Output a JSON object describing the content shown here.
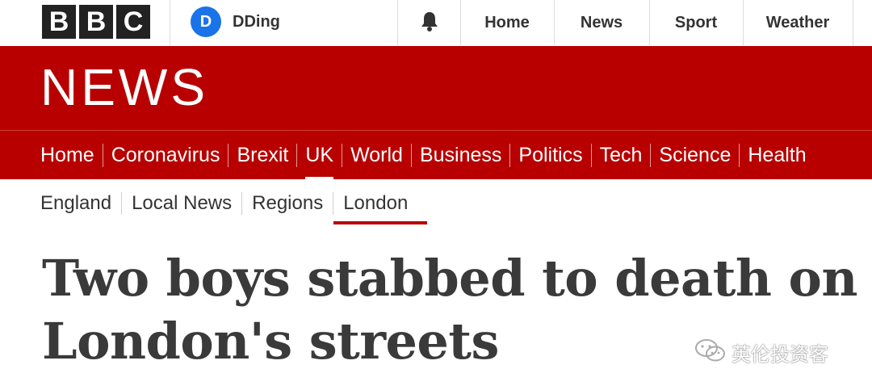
{
  "topbar": {
    "logo_letters": [
      "B",
      "B",
      "C"
    ],
    "account": {
      "initial": "D",
      "name": "DDing"
    },
    "bell_icon": "bell-icon",
    "nav": [
      {
        "label": "Home"
      },
      {
        "label": "News"
      },
      {
        "label": "Sport"
      },
      {
        "label": "Weather"
      }
    ]
  },
  "banner": {
    "title": "NEWS"
  },
  "sections": [
    {
      "label": "Home"
    },
    {
      "label": "Coronavirus"
    },
    {
      "label": "Brexit"
    },
    {
      "label": "UK",
      "active": true
    },
    {
      "label": "World"
    },
    {
      "label": "Business"
    },
    {
      "label": "Politics"
    },
    {
      "label": "Tech"
    },
    {
      "label": "Science"
    },
    {
      "label": "Health"
    }
  ],
  "subnav": [
    {
      "label": "England"
    },
    {
      "label": "Local News"
    },
    {
      "label": "Regions"
    },
    {
      "label": "London",
      "active": true
    }
  ],
  "headline": "Two boys stabbed to death on\nLondon's streets",
  "watermark": {
    "text": "英伦投资客",
    "icon": "wechat-icon"
  },
  "colors": {
    "brand_red": "#b80000",
    "avatar_blue": "#1a73e8",
    "logo_black": "#222222"
  }
}
